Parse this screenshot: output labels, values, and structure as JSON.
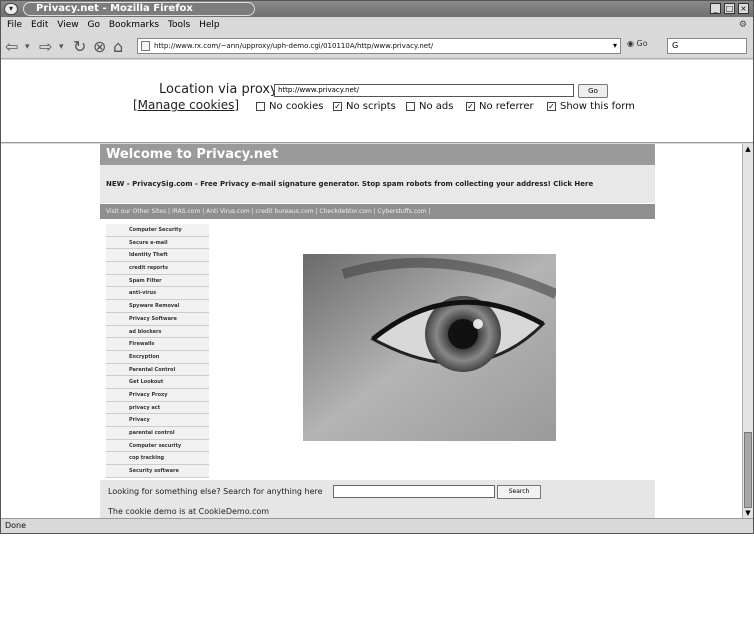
{
  "window": {
    "title": "Privacy.net - Mozilla Firefox",
    "controls": [
      "_",
      "□",
      "×"
    ]
  },
  "menubar": {
    "items": [
      "File",
      "Edit",
      "View",
      "Go",
      "Bookmarks",
      "Tools",
      "Help"
    ]
  },
  "navbar": {
    "url": "http://www.rx.com/~ann/upproxy/uph-demo.cgi/010110A/http/www.privacy.net/",
    "go_label": "Go",
    "search_placeholder": ""
  },
  "proxy_form": {
    "label": "Location via proxy:",
    "url_value": "http://www.privacy.net/",
    "go_button": "Go",
    "manage_cookies": "[Manage cookies]",
    "options": [
      {
        "label": "No cookies",
        "checked": false
      },
      {
        "label": "No scripts",
        "checked": true
      },
      {
        "label": "No ads",
        "checked": false
      },
      {
        "label": "No referrer",
        "checked": true
      },
      {
        "label": "Show this form",
        "checked": true
      }
    ]
  },
  "page": {
    "welcome": "Welcome to Privacy.net",
    "news": "NEW - PrivacySig.com - Free Privacy e-mail signature generator. Stop spam robots from collecting your address! Click Here",
    "sites_bar": "Visit our Other Sites | IRAS.com | Anti Virus.com | credit bureaus.com | Checkdebtor.com | Cyberstuffs.com |",
    "nav_items": [
      "Computer Security",
      "Secure e-mail",
      "Identity Theft",
      "credit reports",
      "Spam Filter",
      "anti-virus",
      "Spyware Removal",
      "Privacy Software",
      "ad blockers",
      "Firewalls",
      "Encryption",
      "Parental Control",
      "Get Lookout",
      "Privacy Proxy",
      "privacy act",
      "Privacy",
      "parental control",
      "Computer security",
      "cop tracking",
      "Security software"
    ],
    "search_label": "Looking for something else? Search for anything here",
    "search_button": "Search",
    "cookie_note": "The cookie demo is at CookieDemo.com"
  },
  "status": "Done"
}
